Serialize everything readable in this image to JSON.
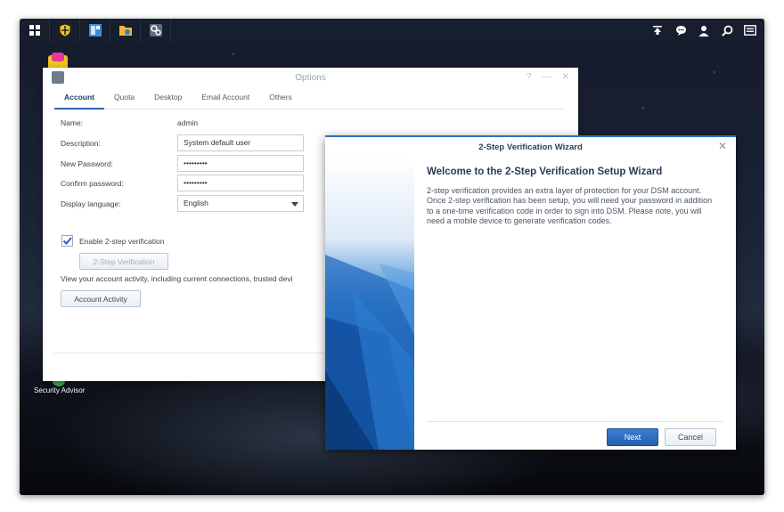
{
  "taskbar": {
    "left_icons": [
      "main-menu-icon",
      "security-advisor-icon",
      "control-panel-icon",
      "file-station-icon",
      "options-app-icon"
    ],
    "right_icons": [
      "upload-icon",
      "chat-icon",
      "user-icon",
      "search-icon",
      "widgets-icon"
    ]
  },
  "desktop": {
    "security_advisor_label": "Security Advisor"
  },
  "options_window": {
    "title": "Options",
    "tabs": [
      "Account",
      "Quota",
      "Desktop",
      "Email Account",
      "Others"
    ],
    "active_tab": "Account",
    "name_label": "Name:",
    "name_value": "admin",
    "description_label": "Description:",
    "description_value": "System default user",
    "new_password_label": "New Password:",
    "new_password_value": "•••••••••",
    "confirm_password_label": "Confirm password:",
    "confirm_password_value": "•••••••••",
    "display_language_label": "Display language:",
    "display_language_value": "English",
    "enable_2step_label": "Enable 2-step verification",
    "enable_2step_checked": true,
    "two_step_button": "2-Step Verification",
    "activity_text": "View your account activity, including current connections, trusted devi",
    "account_activity_button": "Account Activity"
  },
  "wizard": {
    "title": "2-Step Verification Wizard",
    "heading": "Welcome to the 2-Step Verification Setup Wizard",
    "body": "2-step verification provides an extra layer of protection for your DSM account. Once 2-step verification has been setup, you will need your password in addition to a one-time verification code in order to sign into DSM. Please note, you will need a mobile device to generate verification codes.",
    "next_button": "Next",
    "cancel_button": "Cancel"
  },
  "colors": {
    "accent": "#2a63b2",
    "next_button": "#2e6fc4"
  }
}
